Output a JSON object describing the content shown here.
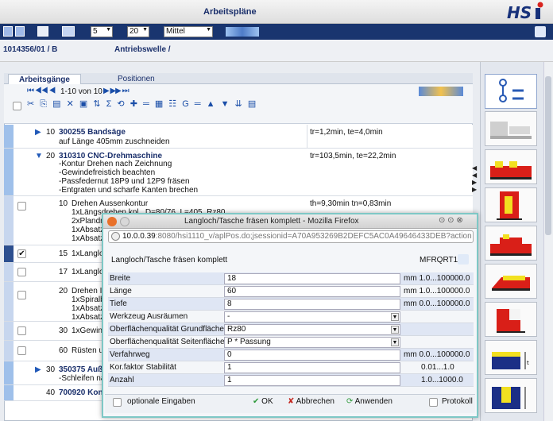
{
  "header": {
    "title": "Arbeitspläne",
    "logo": "HSi"
  },
  "toolbar": {
    "sel1": "5",
    "sel2": "20",
    "sel3": "Mittel"
  },
  "product": {
    "number": "1014356/01 / B",
    "name": "Antriebswelle /"
  },
  "tabs": [
    {
      "label": "Arbeitsgänge"
    },
    {
      "label": "Positionen"
    }
  ],
  "pager": {
    "text": "1-10 von 10"
  },
  "rows": {
    "r10": {
      "num": "10",
      "code": "300255 Bandsäge",
      "desc": "auf Länge 405mm zuschneiden",
      "time": "tr=1,2min, te=4,0min"
    },
    "r20": {
      "num": "20",
      "code": "310310 CNC-Drehmaschine",
      "lines": [
        "-Kontur Drehen nach Zeichnung",
        "-Gewindefreistich beachten",
        "-Passfedernut 18P9 und 12P9 fräsen",
        "-Entgraten und scharfe Kanten brechen"
      ],
      "time": "tr=103,5min, te=22,2min"
    },
    "s10": {
      "num": "10",
      "lines": [
        "Drehen Aussenkontur",
        "1xLängsdrehen kpl., D=80/76, L=405, Rz80",
        "2xPlandre",
        "1xAbsatz",
        "1xAbsatz"
      ],
      "time": "th=9,30min tn=0,83min"
    },
    "s15": {
      "num": "15",
      "text": "1xLangloch"
    },
    "s17": {
      "num": "17",
      "text": "1xLangloch"
    },
    "s20": {
      "num": "20",
      "lines": [
        "Drehen In",
        "1xSpiralb",
        "1xAbsatz",
        "1xAbsatz"
      ]
    },
    "s30": {
      "num": "30",
      "text": "1xGewind"
    },
    "s60": {
      "num": "60",
      "text": "Rüsten u"
    },
    "r30": {
      "num": "30",
      "code": "350375 Auße",
      "desc": "-Schleifen nac"
    },
    "r40": {
      "num": "40",
      "code": "700920 Kontr"
    }
  },
  "dialog": {
    "window_title": "Langloch/Tasche fräsen komplett - Mozilla Firefox",
    "url_host": "10.0.0.39",
    "url_rest": ":8080/hsi1110_v/aplPos.do;jsessionid=A70A953269B2DEFC5AC0A49646433DEB?action",
    "heading": "Langloch/Tasche fräsen komplett",
    "code": "MFRQRT1",
    "fields": [
      {
        "label": "Breite",
        "value": "18",
        "unit": "mm",
        "range": "1.0...100000.0"
      },
      {
        "label": "Länge",
        "value": "60",
        "unit": "mm",
        "range": "1.0...100000.0"
      },
      {
        "label": "Tiefe",
        "value": "8",
        "unit": "mm",
        "range": "0.0...100000.0"
      },
      {
        "label": "Werkzeug Ausräumen",
        "value": "-",
        "unit": "",
        "range": ""
      },
      {
        "label": "Oberflächenqualität Grundfläche",
        "value": "Rz80",
        "unit": "",
        "range": ""
      },
      {
        "label": "Oberflächenqualität Seitenfläche",
        "value": "P * Passung",
        "unit": "",
        "range": ""
      },
      {
        "label": "Verfahrweg",
        "value": "0",
        "unit": "mm",
        "range": "0.0...100000.0"
      },
      {
        "label": "Kor.faktor Stabilität",
        "value": "1",
        "unit": "",
        "range": "0.01...1.0"
      },
      {
        "label": "Anzahl",
        "value": "1",
        "unit": "",
        "range": "1.0...1000.0"
      }
    ],
    "footer": {
      "optional": "optionale Eingaben",
      "ok": "OK",
      "cancel": "Abbrechen",
      "apply": "Anwenden",
      "protocol": "Protokoll"
    }
  }
}
